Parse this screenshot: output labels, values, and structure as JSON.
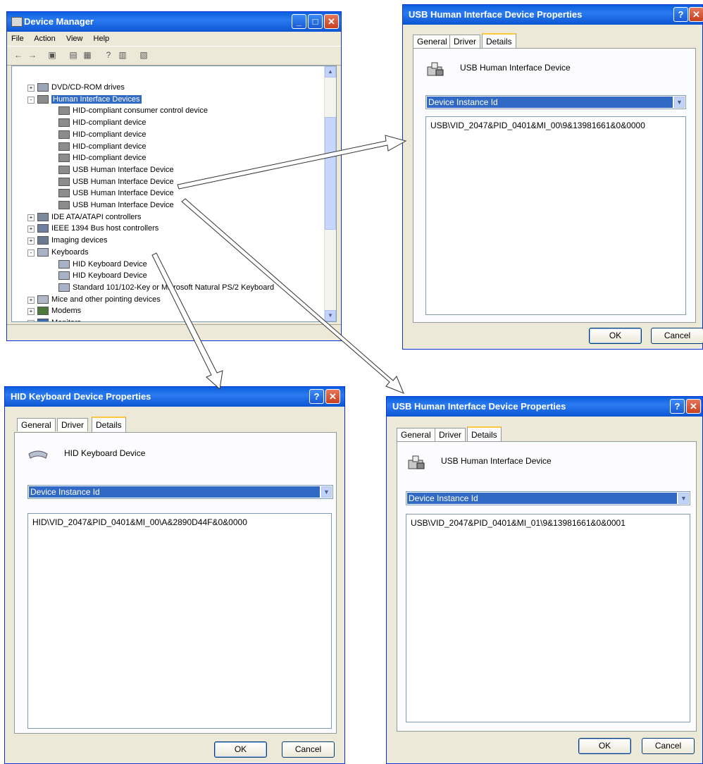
{
  "device_manager": {
    "title": "Device Manager",
    "menu": [
      "File",
      "Action",
      "View",
      "Help"
    ],
    "tree": [
      {
        "label": "DVD/CD-ROM drives",
        "level": 1,
        "icon": "cdrom-icon",
        "expander": "+"
      },
      {
        "label": "Human Interface Devices",
        "level": 1,
        "icon": "hid-icon",
        "expander": "-",
        "selected": true
      },
      {
        "label": "HID-compliant consumer control device",
        "level": 2,
        "icon": "hid-icon"
      },
      {
        "label": "HID-compliant device",
        "level": 2,
        "icon": "hid-icon"
      },
      {
        "label": "HID-compliant device",
        "level": 2,
        "icon": "hid-icon"
      },
      {
        "label": "HID-compliant device",
        "level": 2,
        "icon": "hid-icon"
      },
      {
        "label": "HID-compliant device",
        "level": 2,
        "icon": "hid-icon"
      },
      {
        "label": "USB Human Interface Device",
        "level": 2,
        "icon": "hid-icon"
      },
      {
        "label": "USB Human Interface Device",
        "level": 2,
        "icon": "hid-icon"
      },
      {
        "label": "USB Human Interface Device",
        "level": 2,
        "icon": "hid-icon"
      },
      {
        "label": "USB Human Interface Device",
        "level": 2,
        "icon": "hid-icon"
      },
      {
        "label": "IDE ATA/ATAPI controllers",
        "level": 1,
        "icon": "ide-icon",
        "expander": "+"
      },
      {
        "label": "IEEE 1394 Bus host controllers",
        "level": 1,
        "icon": "firewire-icon",
        "expander": "+"
      },
      {
        "label": "Imaging devices",
        "level": 1,
        "icon": "camera-icon",
        "expander": "+"
      },
      {
        "label": "Keyboards",
        "level": 1,
        "icon": "keyboard-icon",
        "expander": "-"
      },
      {
        "label": "HID Keyboard Device",
        "level": 2,
        "icon": "keyboard-icon"
      },
      {
        "label": "HID Keyboard Device",
        "level": 2,
        "icon": "keyboard-icon"
      },
      {
        "label": "Standard 101/102-Key or Microsoft Natural PS/2 Keyboard",
        "level": 2,
        "icon": "keyboard-icon"
      },
      {
        "label": "Mice and other pointing devices",
        "level": 1,
        "icon": "mouse-icon",
        "expander": "+"
      },
      {
        "label": "Modems",
        "level": 1,
        "icon": "modem-icon",
        "expander": "+"
      },
      {
        "label": "Monitors",
        "level": 1,
        "icon": "monitor-icon",
        "expander": "+"
      }
    ]
  },
  "dialog_usb1": {
    "title": "USB Human Interface Device Properties",
    "tabs": [
      "General",
      "Driver",
      "Details"
    ],
    "device_name": "USB Human Interface Device",
    "property": "Device Instance Id",
    "value": "USB\\VID_2047&PID_0401&MI_00\\9&13981661&0&0000",
    "ok": "OK",
    "cancel": "Cancel"
  },
  "dialog_hid_kbd": {
    "title": "HID Keyboard Device Properties",
    "tabs": [
      "General",
      "Driver",
      "Details"
    ],
    "device_name": "HID Keyboard Device",
    "property": "Device Instance Id",
    "value": "HID\\VID_2047&PID_0401&MI_00\\A&2890D44F&0&0000",
    "ok": "OK",
    "cancel": "Cancel"
  },
  "dialog_usb2": {
    "title": "USB Human Interface Device Properties",
    "tabs": [
      "General",
      "Driver",
      "Details"
    ],
    "device_name": "USB Human Interface Device",
    "property": "Device Instance Id",
    "value": "USB\\VID_2047&PID_0401&MI_01\\9&13981661&0&0001",
    "ok": "OK",
    "cancel": "Cancel"
  },
  "colors": {
    "titlebar": "#0a5fdc",
    "selection": "#316ac5",
    "window_bg": "#ece9d8",
    "arrow_fill": "#ffffff"
  }
}
